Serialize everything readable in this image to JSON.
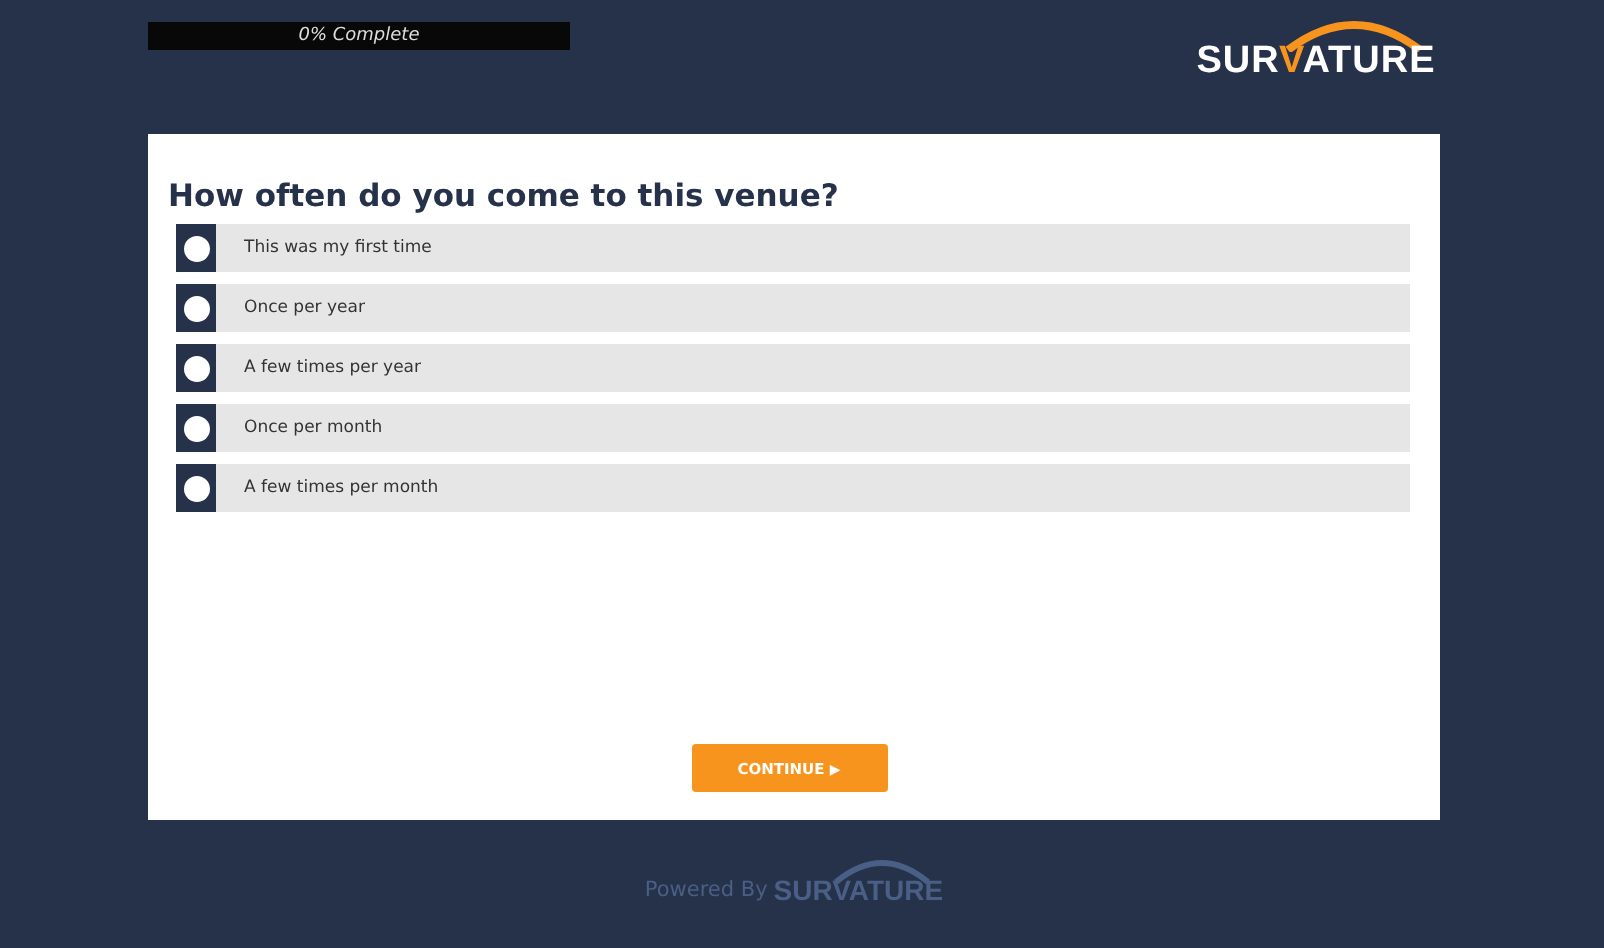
{
  "progress": {
    "label": "0% Complete",
    "level": 0
  },
  "logo": {
    "parts": [
      {
        "text": "SUR",
        "accent": false
      },
      {
        "text": "V",
        "accent": true
      },
      {
        "text": "ATURE",
        "accent": false
      }
    ]
  },
  "question": "How often do you come to this venue?",
  "options": [
    {
      "label": "This was my first time",
      "selected": false
    },
    {
      "label": "Once per year",
      "selected": false
    },
    {
      "label": "A few times per year",
      "selected": false
    },
    {
      "label": "Once per month",
      "selected": false
    },
    {
      "label": "A few times per month",
      "selected": false
    }
  ],
  "continue_button": {
    "label": "CONTINUE",
    "icon": "▶"
  },
  "footer": {
    "prefix": "Powered By",
    "logo": "SURVATURE"
  }
}
